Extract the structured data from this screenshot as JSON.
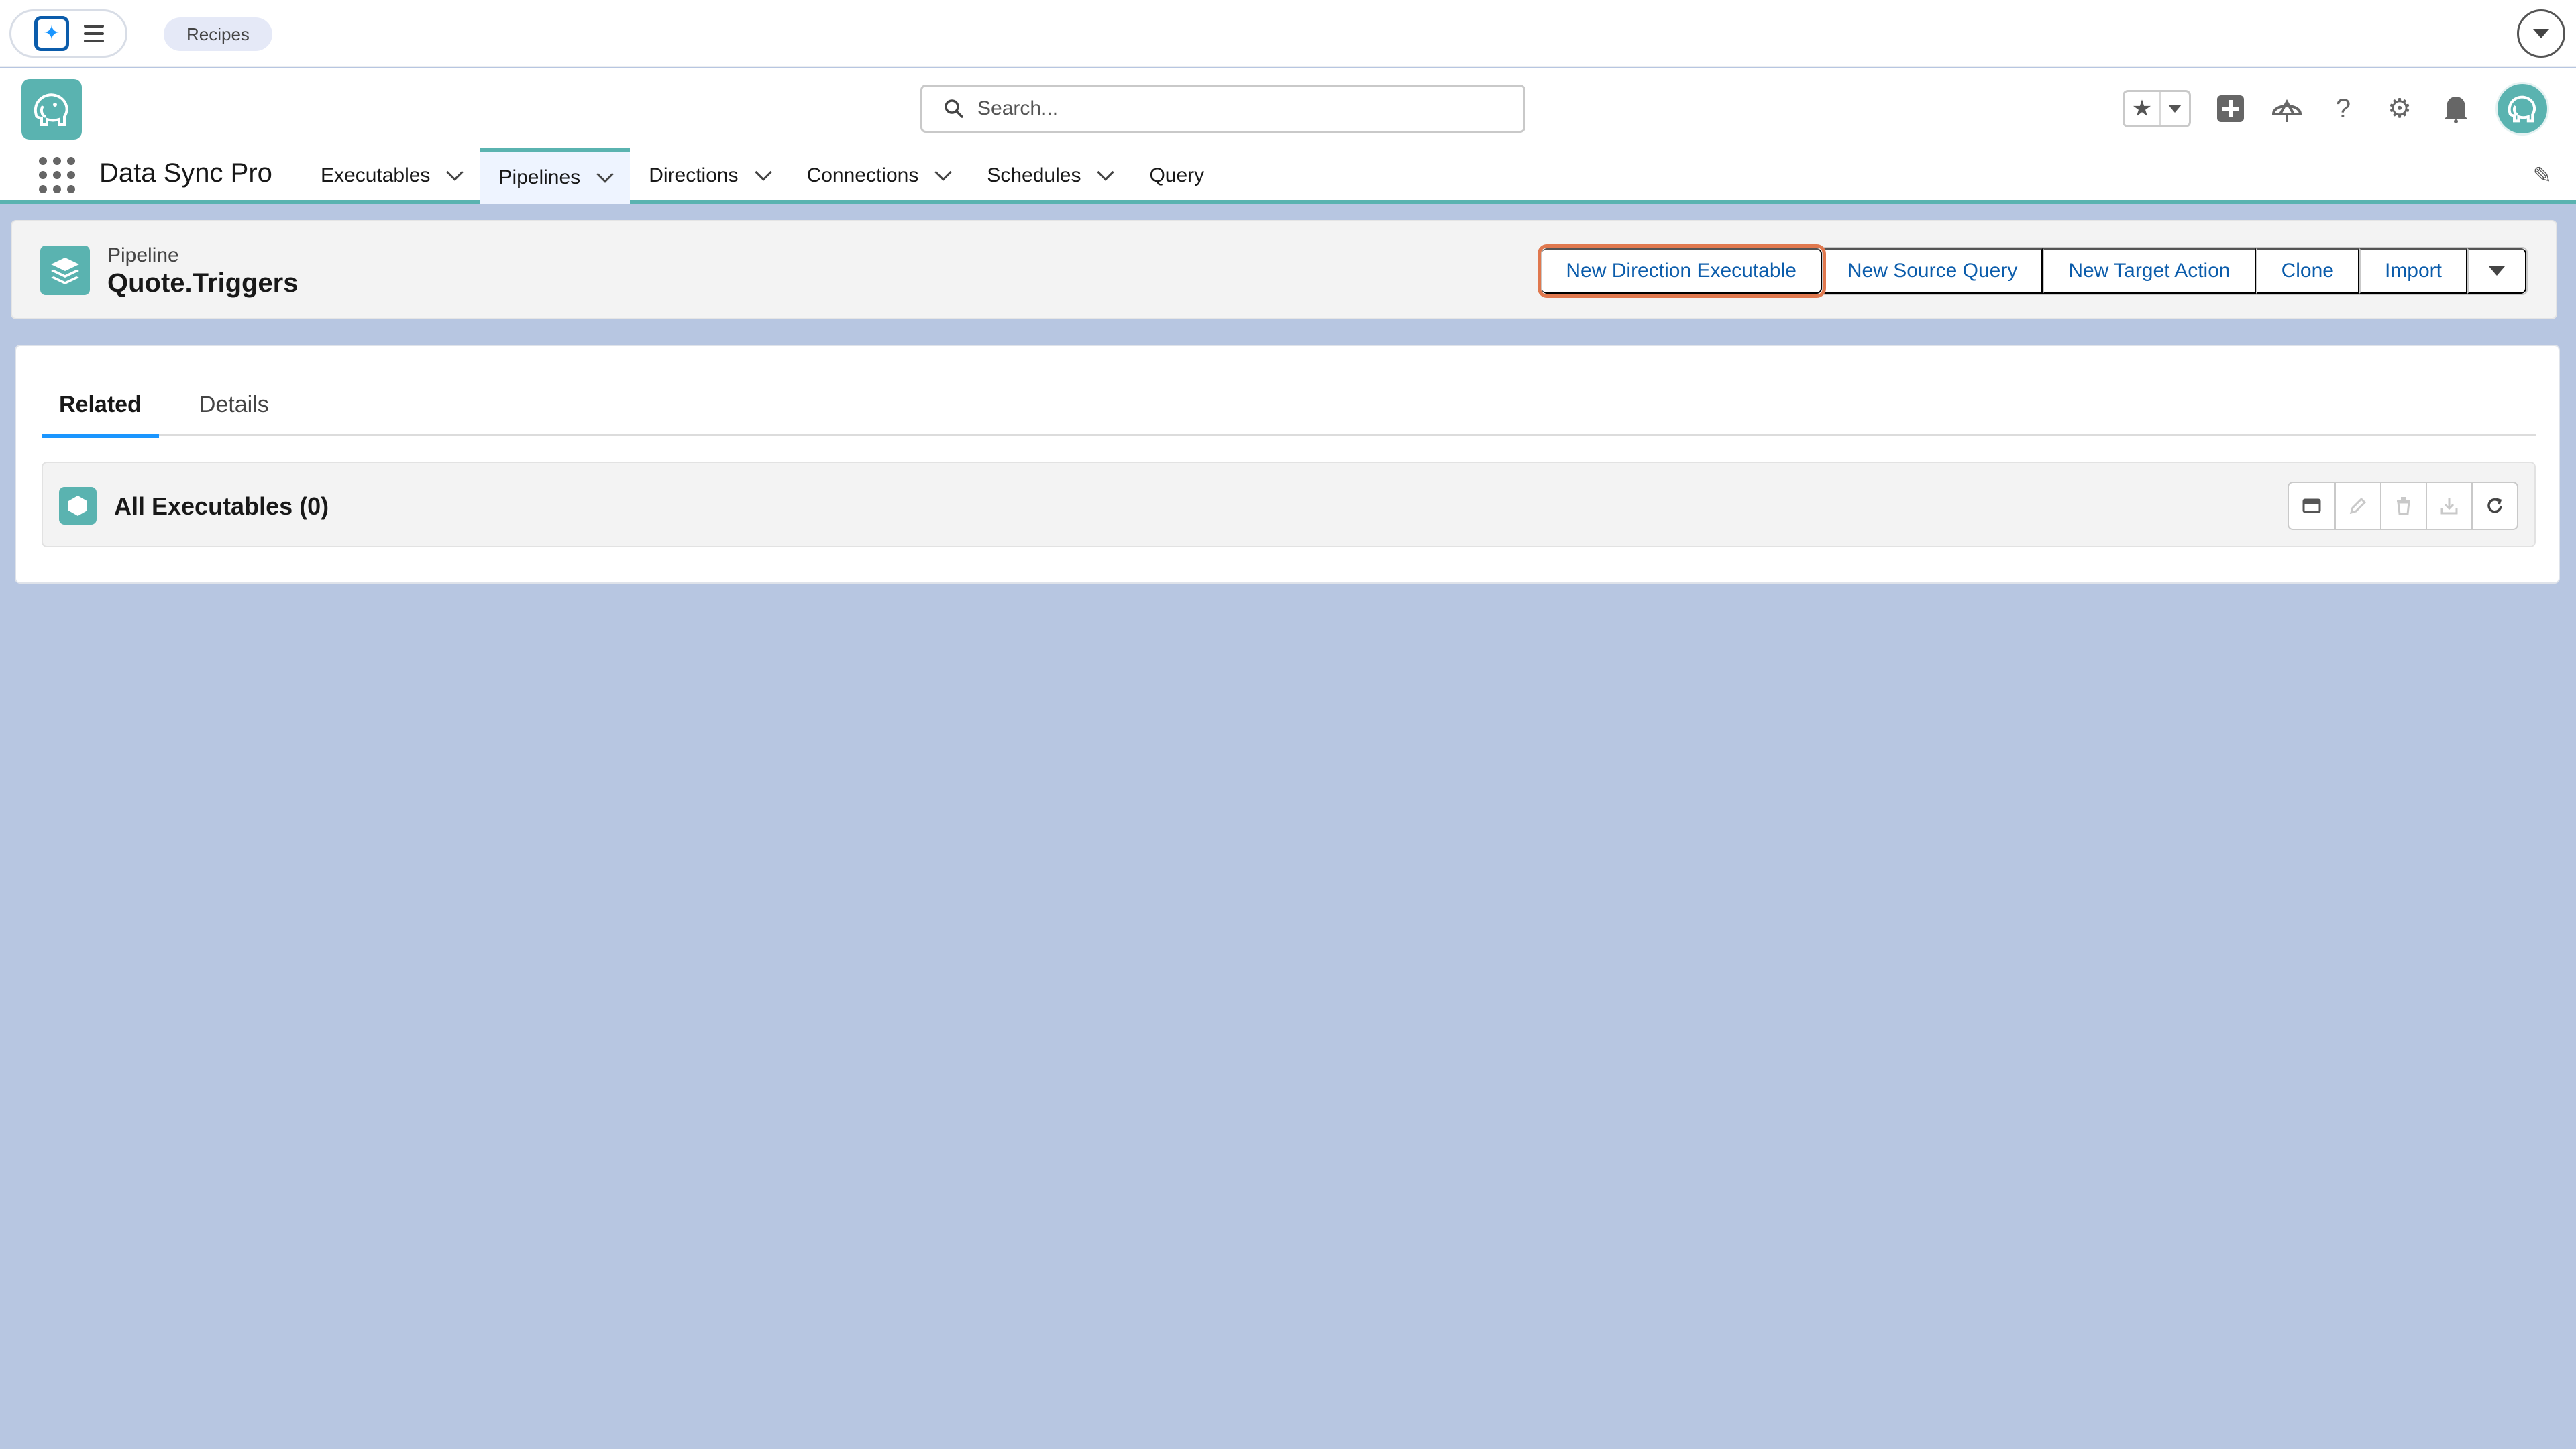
{
  "top_strip": {
    "recipes_label": "Recipes"
  },
  "header": {
    "search_placeholder": "Search..."
  },
  "nav": {
    "app_name": "Data Sync Pro",
    "tabs": [
      {
        "label": "Executables",
        "has_menu": true,
        "active": false
      },
      {
        "label": "Pipelines",
        "has_menu": true,
        "active": true
      },
      {
        "label": "Directions",
        "has_menu": true,
        "active": false
      },
      {
        "label": "Connections",
        "has_menu": true,
        "active": false
      },
      {
        "label": "Schedules",
        "has_menu": true,
        "active": false
      },
      {
        "label": "Query",
        "has_menu": false,
        "active": false
      }
    ]
  },
  "record": {
    "type_label": "Pipeline",
    "title": "Quote.Triggers",
    "actions": [
      {
        "label": "New Direction Executable",
        "focused": true
      },
      {
        "label": "New Source Query",
        "focused": false
      },
      {
        "label": "New Target Action",
        "focused": false
      },
      {
        "label": "Clone",
        "focused": false
      },
      {
        "label": "Import",
        "focused": false
      }
    ]
  },
  "related": {
    "tabs": [
      {
        "label": "Related",
        "active": true
      },
      {
        "label": "Details",
        "active": false
      }
    ],
    "list": {
      "title": "All Executables (0)"
    }
  },
  "colors": {
    "brand_teal": "#5ab3b0",
    "link_blue": "#0b5cab",
    "focus_orange": "#e0784e",
    "page_background": "#b7c6e1"
  }
}
